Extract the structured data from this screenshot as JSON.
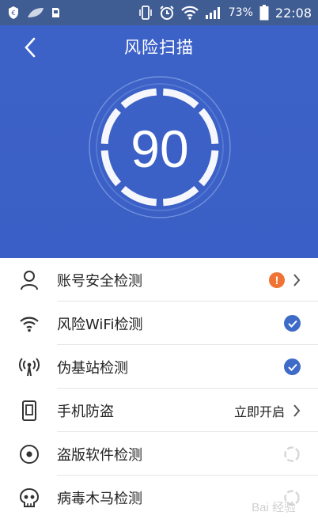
{
  "status_bar": {
    "battery": "73%",
    "time": "22:08"
  },
  "header": {
    "title": "风险扫描"
  },
  "score": {
    "value": "90"
  },
  "items": [
    {
      "label": "账号安全检测",
      "status": "warning",
      "status_text": "!"
    },
    {
      "label": "风险WiFi检测",
      "status": "ok"
    },
    {
      "label": "伪基站检测",
      "status": "ok"
    },
    {
      "label": "手机防盗",
      "action": "立即开启"
    },
    {
      "label": "盗版软件检测",
      "status": "scanning"
    },
    {
      "label": "病毒木马检测",
      "status": "scanning"
    }
  ],
  "watermark": "Bai 经验",
  "colors": {
    "hero_bg": "#3D62C7",
    "warning": "#F07336",
    "check": "#3D6BC7"
  }
}
